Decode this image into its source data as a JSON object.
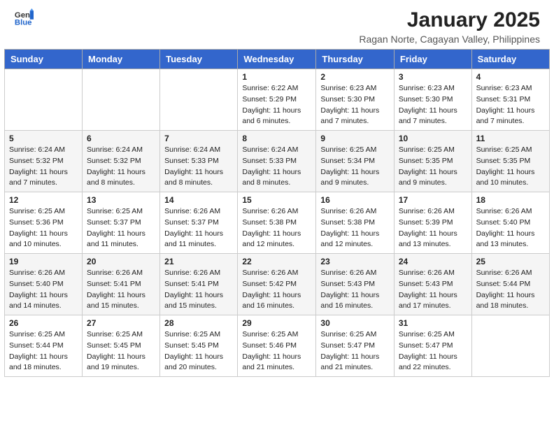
{
  "header": {
    "logo_line1": "General",
    "logo_line2": "Blue",
    "month": "January 2025",
    "location": "Ragan Norte, Cagayan Valley, Philippines"
  },
  "weekdays": [
    "Sunday",
    "Monday",
    "Tuesday",
    "Wednesday",
    "Thursday",
    "Friday",
    "Saturday"
  ],
  "weeks": [
    [
      {
        "day": "",
        "info": ""
      },
      {
        "day": "",
        "info": ""
      },
      {
        "day": "",
        "info": ""
      },
      {
        "day": "1",
        "info": "Sunrise: 6:22 AM\nSunset: 5:29 PM\nDaylight: 11 hours and 6 minutes."
      },
      {
        "day": "2",
        "info": "Sunrise: 6:23 AM\nSunset: 5:30 PM\nDaylight: 11 hours and 7 minutes."
      },
      {
        "day": "3",
        "info": "Sunrise: 6:23 AM\nSunset: 5:30 PM\nDaylight: 11 hours and 7 minutes."
      },
      {
        "day": "4",
        "info": "Sunrise: 6:23 AM\nSunset: 5:31 PM\nDaylight: 11 hours and 7 minutes."
      }
    ],
    [
      {
        "day": "5",
        "info": "Sunrise: 6:24 AM\nSunset: 5:32 PM\nDaylight: 11 hours and 7 minutes."
      },
      {
        "day": "6",
        "info": "Sunrise: 6:24 AM\nSunset: 5:32 PM\nDaylight: 11 hours and 8 minutes."
      },
      {
        "day": "7",
        "info": "Sunrise: 6:24 AM\nSunset: 5:33 PM\nDaylight: 11 hours and 8 minutes."
      },
      {
        "day": "8",
        "info": "Sunrise: 6:24 AM\nSunset: 5:33 PM\nDaylight: 11 hours and 8 minutes."
      },
      {
        "day": "9",
        "info": "Sunrise: 6:25 AM\nSunset: 5:34 PM\nDaylight: 11 hours and 9 minutes."
      },
      {
        "day": "10",
        "info": "Sunrise: 6:25 AM\nSunset: 5:35 PM\nDaylight: 11 hours and 9 minutes."
      },
      {
        "day": "11",
        "info": "Sunrise: 6:25 AM\nSunset: 5:35 PM\nDaylight: 11 hours and 10 minutes."
      }
    ],
    [
      {
        "day": "12",
        "info": "Sunrise: 6:25 AM\nSunset: 5:36 PM\nDaylight: 11 hours and 10 minutes."
      },
      {
        "day": "13",
        "info": "Sunrise: 6:25 AM\nSunset: 5:37 PM\nDaylight: 11 hours and 11 minutes."
      },
      {
        "day": "14",
        "info": "Sunrise: 6:26 AM\nSunset: 5:37 PM\nDaylight: 11 hours and 11 minutes."
      },
      {
        "day": "15",
        "info": "Sunrise: 6:26 AM\nSunset: 5:38 PM\nDaylight: 11 hours and 12 minutes."
      },
      {
        "day": "16",
        "info": "Sunrise: 6:26 AM\nSunset: 5:38 PM\nDaylight: 11 hours and 12 minutes."
      },
      {
        "day": "17",
        "info": "Sunrise: 6:26 AM\nSunset: 5:39 PM\nDaylight: 11 hours and 13 minutes."
      },
      {
        "day": "18",
        "info": "Sunrise: 6:26 AM\nSunset: 5:40 PM\nDaylight: 11 hours and 13 minutes."
      }
    ],
    [
      {
        "day": "19",
        "info": "Sunrise: 6:26 AM\nSunset: 5:40 PM\nDaylight: 11 hours and 14 minutes."
      },
      {
        "day": "20",
        "info": "Sunrise: 6:26 AM\nSunset: 5:41 PM\nDaylight: 11 hours and 15 minutes."
      },
      {
        "day": "21",
        "info": "Sunrise: 6:26 AM\nSunset: 5:41 PM\nDaylight: 11 hours and 15 minutes."
      },
      {
        "day": "22",
        "info": "Sunrise: 6:26 AM\nSunset: 5:42 PM\nDaylight: 11 hours and 16 minutes."
      },
      {
        "day": "23",
        "info": "Sunrise: 6:26 AM\nSunset: 5:43 PM\nDaylight: 11 hours and 16 minutes."
      },
      {
        "day": "24",
        "info": "Sunrise: 6:26 AM\nSunset: 5:43 PM\nDaylight: 11 hours and 17 minutes."
      },
      {
        "day": "25",
        "info": "Sunrise: 6:26 AM\nSunset: 5:44 PM\nDaylight: 11 hours and 18 minutes."
      }
    ],
    [
      {
        "day": "26",
        "info": "Sunrise: 6:25 AM\nSunset: 5:44 PM\nDaylight: 11 hours and 18 minutes."
      },
      {
        "day": "27",
        "info": "Sunrise: 6:25 AM\nSunset: 5:45 PM\nDaylight: 11 hours and 19 minutes."
      },
      {
        "day": "28",
        "info": "Sunrise: 6:25 AM\nSunset: 5:45 PM\nDaylight: 11 hours and 20 minutes."
      },
      {
        "day": "29",
        "info": "Sunrise: 6:25 AM\nSunset: 5:46 PM\nDaylight: 11 hours and 21 minutes."
      },
      {
        "day": "30",
        "info": "Sunrise: 6:25 AM\nSunset: 5:47 PM\nDaylight: 11 hours and 21 minutes."
      },
      {
        "day": "31",
        "info": "Sunrise: 6:25 AM\nSunset: 5:47 PM\nDaylight: 11 hours and 22 minutes."
      },
      {
        "day": "",
        "info": ""
      }
    ]
  ]
}
